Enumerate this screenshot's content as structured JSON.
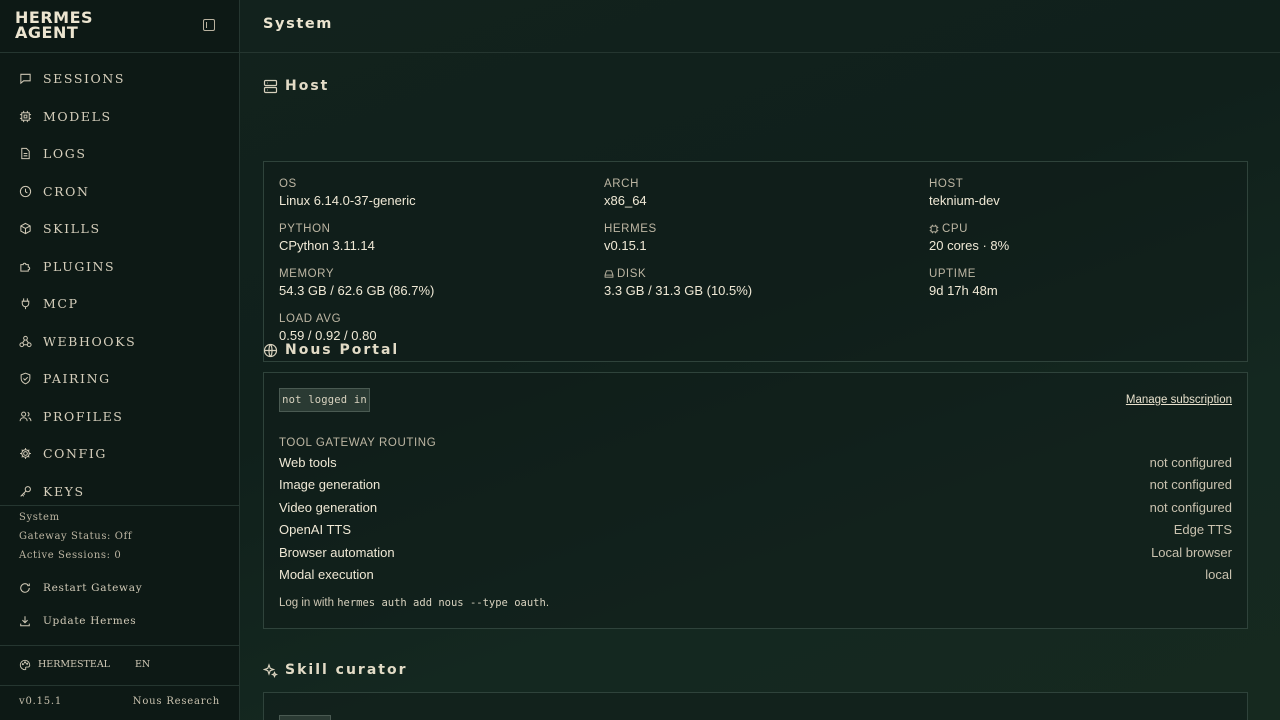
{
  "brand": {
    "line1": "HERMES",
    "line2": "AGENT"
  },
  "nav": [
    {
      "label": "SESSIONS",
      "icon": "chat-icon"
    },
    {
      "label": "MODELS",
      "icon": "cpu-icon"
    },
    {
      "label": "LOGS",
      "icon": "file-icon"
    },
    {
      "label": "CRON",
      "icon": "clock-icon"
    },
    {
      "label": "SKILLS",
      "icon": "package-icon"
    },
    {
      "label": "PLUGINS",
      "icon": "puzzle-icon"
    },
    {
      "label": "MCP",
      "icon": "plug-icon"
    },
    {
      "label": "WEBHOOKS",
      "icon": "webhook-icon"
    },
    {
      "label": "PAIRING",
      "icon": "shield-check-icon"
    },
    {
      "label": "PROFILES",
      "icon": "users-icon"
    },
    {
      "label": "CONFIG",
      "icon": "gear-icon"
    },
    {
      "label": "KEYS",
      "icon": "key-icon"
    }
  ],
  "status": {
    "system": "System",
    "gateway": "Gateway Status: Off",
    "sessions": "Active Sessions: 0"
  },
  "actions": {
    "restart": "Restart Gateway",
    "update": "Update Hermes"
  },
  "theme": {
    "name": "HERMESTEAL",
    "lang": "EN"
  },
  "footer": {
    "version": "v0.15.1",
    "org": "Nous Research"
  },
  "page": {
    "title": "System"
  },
  "host": {
    "heading": "Host",
    "os": {
      "label": "OS",
      "value": "Linux 6.14.0-37-generic"
    },
    "arch": {
      "label": "ARCH",
      "value": "x86_64"
    },
    "hostname": {
      "label": "HOST",
      "value": "teknium-dev"
    },
    "python": {
      "label": "PYTHON",
      "value": "CPython 3.11.14"
    },
    "hermes": {
      "label": "HERMES",
      "value": "v0.15.1"
    },
    "cpu": {
      "label": "CPU",
      "value": "20 cores · 8%"
    },
    "memory": {
      "label": "MEMORY",
      "value": "54.3 GB / 62.6 GB (86.7%)"
    },
    "disk": {
      "label": "DISK",
      "value": "3.3 GB / 31.3 GB (10.5%)"
    },
    "uptime": {
      "label": "UPTIME",
      "value": "9d 17h 48m"
    },
    "load": {
      "label": "LOAD AVG",
      "value": "0.59 / 0.92 / 0.80"
    }
  },
  "portal": {
    "heading": "Nous Portal",
    "badge": "not logged in",
    "manage": "Manage subscription",
    "routing_label": "TOOL GATEWAY ROUTING",
    "routes": [
      {
        "name": "Web tools",
        "value": "not configured"
      },
      {
        "name": "Image generation",
        "value": "not configured"
      },
      {
        "name": "Video generation",
        "value": "not configured"
      },
      {
        "name": "OpenAI TTS",
        "value": "Edge TTS"
      },
      {
        "name": "Browser automation",
        "value": "Local browser"
      },
      {
        "name": "Modal execution",
        "value": "local"
      }
    ],
    "hint_prefix": "Log in with",
    "hint_cmd": "hermes auth add nous --type oauth",
    "hint_suffix": "."
  },
  "curator": {
    "heading": "Skill curator"
  }
}
